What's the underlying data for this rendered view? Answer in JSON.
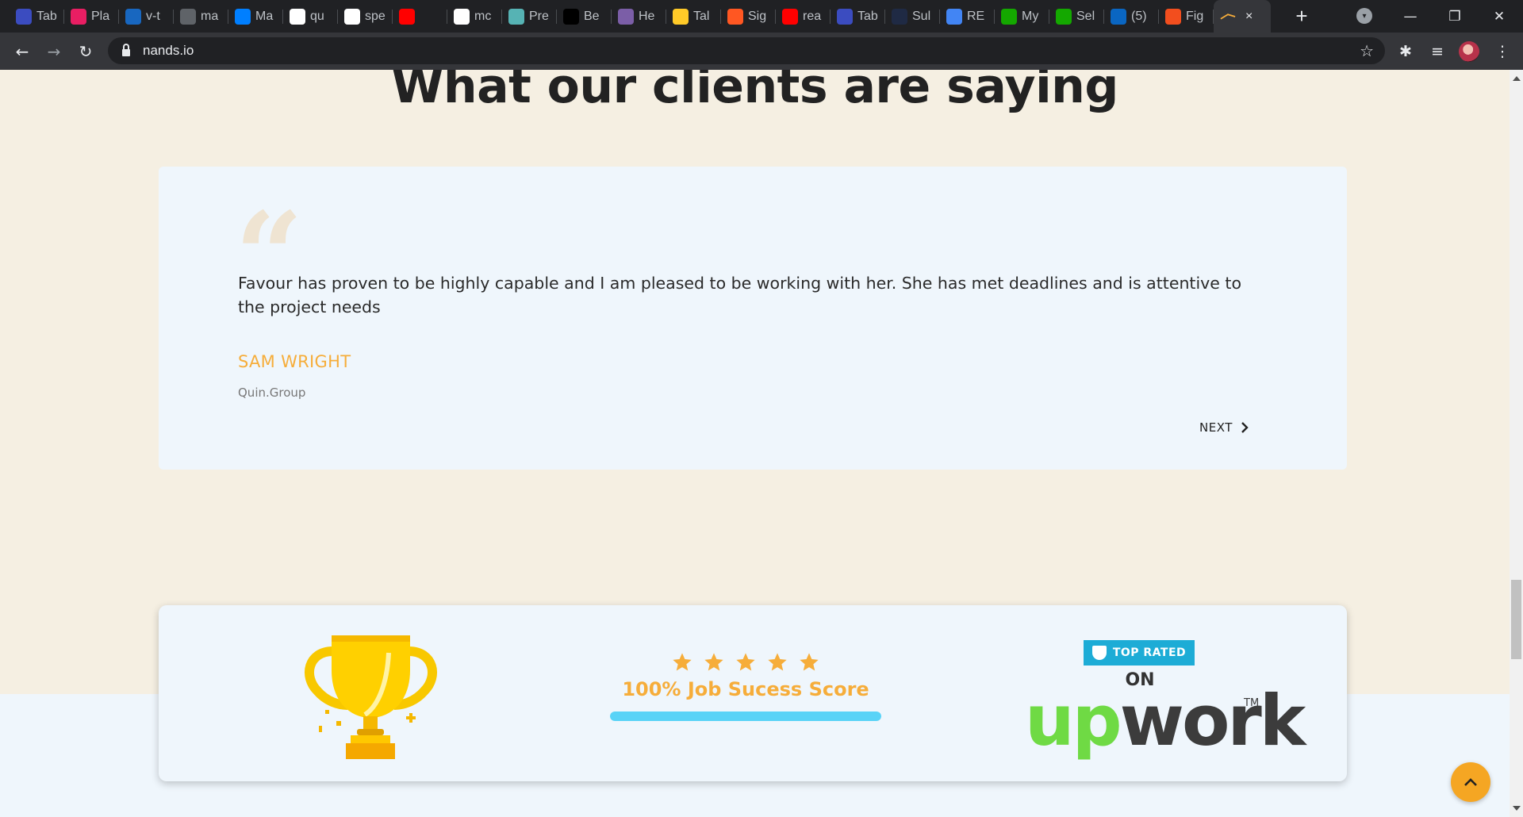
{
  "browser": {
    "tabs": [
      {
        "label": "Tab",
        "icon": "bars-icon",
        "color": "#3b4cc0"
      },
      {
        "label": "Pla",
        "icon": "pink-square-icon",
        "color": "#e91e63"
      },
      {
        "label": "v-t",
        "icon": "vuetify-icon",
        "color": "#1867c0"
      },
      {
        "label": "ma",
        "icon": "globe-icon",
        "color": "#5f6368"
      },
      {
        "label": "Ma",
        "icon": "mui-icon",
        "color": "#007fff"
      },
      {
        "label": "qu",
        "icon": "github-icon",
        "color": "#ffffff"
      },
      {
        "label": "spe",
        "icon": "github-icon",
        "color": "#ffffff"
      },
      {
        "label": "",
        "icon": "youtube-icon",
        "color": "#ff0000"
      },
      {
        "label": "mc",
        "icon": "github-icon",
        "color": "#ffffff"
      },
      {
        "label": "Pre",
        "icon": "prettier-icon",
        "color": "#56b3b4"
      },
      {
        "label": "Be",
        "icon": "dev-icon",
        "color": "#000000"
      },
      {
        "label": "He",
        "icon": "h-icon",
        "color": "#7b5ea7"
      },
      {
        "label": "Tal",
        "icon": "firebase-icon",
        "color": "#ffca28"
      },
      {
        "label": "Sig",
        "icon": "sig-icon",
        "color": "#ff5722"
      },
      {
        "label": "rea",
        "icon": "youtube-icon",
        "color": "#ff0000"
      },
      {
        "label": "Tab",
        "icon": "bars-icon",
        "color": "#3b4cc0"
      },
      {
        "label": "Sul",
        "icon": "dark-icon",
        "color": "#1f2a44"
      },
      {
        "label": "RE",
        "icon": "docs-icon",
        "color": "#4285f4"
      },
      {
        "label": "My",
        "icon": "upwork-icon",
        "color": "#14a800"
      },
      {
        "label": "Sel",
        "icon": "upwork-icon",
        "color": "#14a800"
      },
      {
        "label": "(5)",
        "icon": "linkedin-icon",
        "color": "#0a66c2"
      },
      {
        "label": "Fig",
        "icon": "figma-icon",
        "color": "#f24e1e"
      }
    ],
    "active_tab": {
      "icon": "nands-icon",
      "close": "×"
    },
    "new_tab": "+",
    "url": "nands.io"
  },
  "page": {
    "heading": "What our clients are saying",
    "testimonial": {
      "quote": "Favour has proven to be highly capable and I am pleased to be working with her. She has met deadlines and is attentive to the project needs",
      "author": "SAM WRIGHT",
      "company": "Quin.Group",
      "next_label": "NEXT"
    },
    "badges": {
      "stars": 5,
      "score_label": "100% Job Sucess Score",
      "score_percent": 100,
      "top_rated": "TOP RATED",
      "on": "ON",
      "upwork_up": "up",
      "upwork_work": "work",
      "tm": "TM"
    }
  },
  "colors": {
    "accent": "#f6ad3a",
    "page_bg": "#f5efe2",
    "card_bg": "#eff6fc",
    "bar": "#59d3f7",
    "upwork_green": "#6fda44",
    "badge_blue": "#1dacd6"
  }
}
